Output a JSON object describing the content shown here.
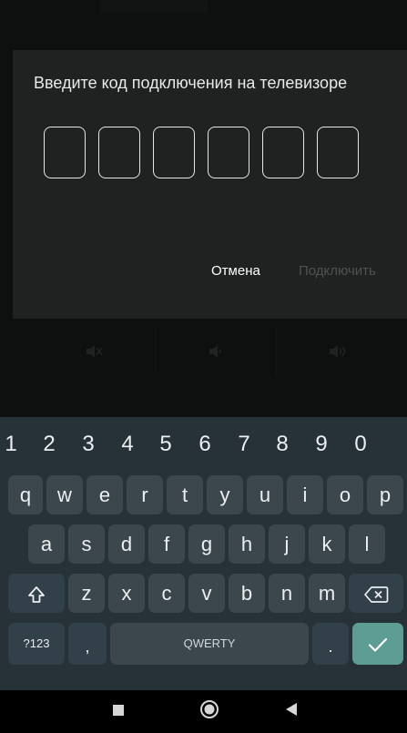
{
  "dialog": {
    "title": "Введите код подключения на телевизоре",
    "cancel_label": "Отмена",
    "connect_label": "Подключить",
    "code_digits": [
      "",
      "",
      "",
      "",
      "",
      ""
    ]
  },
  "background": {
    "icons": [
      "volume-mute-icon",
      "volume-down-icon",
      "volume-up-icon"
    ]
  },
  "keyboard": {
    "number_row": [
      "1",
      "2",
      "3",
      "4",
      "5",
      "6",
      "7",
      "8",
      "9",
      "0"
    ],
    "row1": [
      "q",
      "w",
      "e",
      "r",
      "t",
      "y",
      "u",
      "i",
      "o",
      "p"
    ],
    "row2": [
      "a",
      "s",
      "d",
      "f",
      "g",
      "h",
      "j",
      "k",
      "l"
    ],
    "row3": [
      "z",
      "x",
      "c",
      "v",
      "b",
      "n",
      "m"
    ],
    "symbols_label": "?123",
    "comma_label": ",",
    "space_label": "QWERTY",
    "period_label": ".",
    "colors": {
      "bg": "#263238",
      "key": "#3b474c",
      "enter": "#5d9d94"
    }
  },
  "navbar": {
    "icons": [
      "recents-square-icon",
      "home-circle-icon",
      "back-triangle-icon"
    ]
  }
}
